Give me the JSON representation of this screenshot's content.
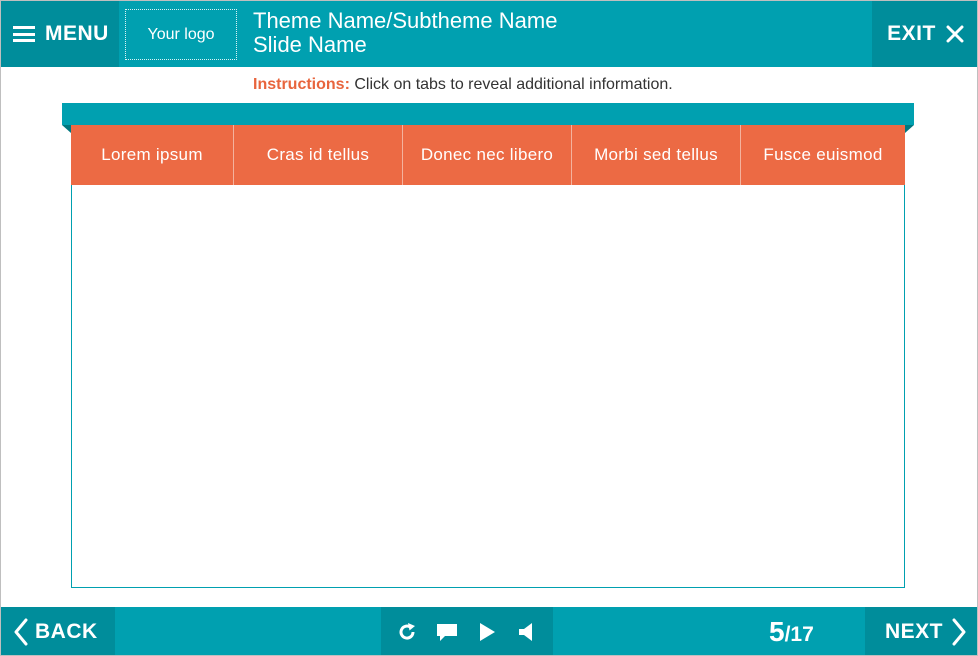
{
  "header": {
    "menu_label": "MENU",
    "logo_text": "Your logo",
    "title": "Theme Name/Subtheme Name",
    "subtitle": "Slide Name",
    "exit_label": "EXIT"
  },
  "instructions": {
    "lead": "Instructions:",
    "text": " Click on tabs to reveal additional information."
  },
  "tabs": [
    {
      "label": "Lorem ipsum"
    },
    {
      "label": "Cras id tellus"
    },
    {
      "label": "Donec nec libero"
    },
    {
      "label": "Morbi sed tellus"
    },
    {
      "label": "Fusce euismod"
    }
  ],
  "footer": {
    "back_label": "BACK",
    "next_label": "NEXT",
    "page_current": "5",
    "page_total": "/17",
    "controls": [
      "replay-icon",
      "comment-icon",
      "play-icon",
      "volume-icon"
    ]
  },
  "colors": {
    "primary": "#00a0b0",
    "primary_dark": "#008d9b",
    "accent": "#ec6a44"
  }
}
